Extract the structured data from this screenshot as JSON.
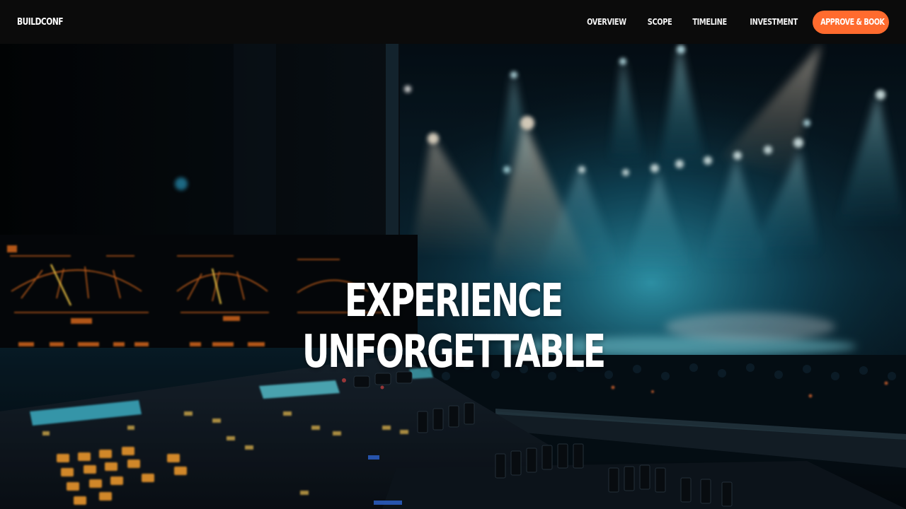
{
  "nav": {
    "brand": "BUILDCONF",
    "links": [
      "OVERVIEW",
      "SCOPE",
      "TIMELINE",
      "INVESTMENT"
    ],
    "cta_label": "APPROVE & BOOK"
  },
  "hero": {
    "title_line_1": "EXPERIENCE",
    "title_line_2": "UNFORGETTABLE",
    "background_image": "concert-stage-with-lighting-console"
  },
  "colors": {
    "nav_bg": "#0b0b0b",
    "accent": "#ff6b2e",
    "text": "#ffffff"
  }
}
